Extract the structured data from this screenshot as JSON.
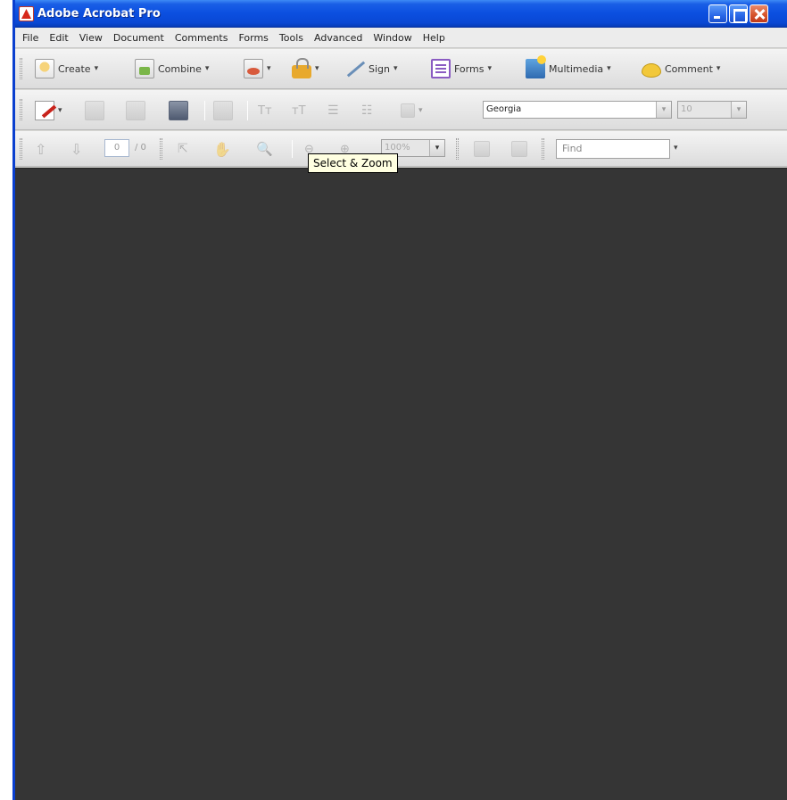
{
  "window": {
    "title": "Adobe Acrobat Pro",
    "title_color": "#0a48d4",
    "close_button_color": "#d6552c"
  },
  "menu": {
    "items": [
      "File",
      "Edit",
      "View",
      "Document",
      "Comments",
      "Forms",
      "Tools",
      "Advanced",
      "Window",
      "Help"
    ]
  },
  "toolbar1": {
    "create": "Create",
    "combine": "Combine",
    "sign": "Sign",
    "forms": "Forms",
    "multimedia": "Multimedia",
    "comment": "Comment",
    "caret": "▾"
  },
  "toolbar2": {
    "font": "Georgia",
    "font_size": "10"
  },
  "toolbar3": {
    "page_number": "0",
    "page_total": "/ 0",
    "zoom": "100%",
    "find_placeholder": "Find"
  },
  "tooltip": {
    "text": "Select & Zoom"
  },
  "document_area": {
    "background": "#353535"
  }
}
